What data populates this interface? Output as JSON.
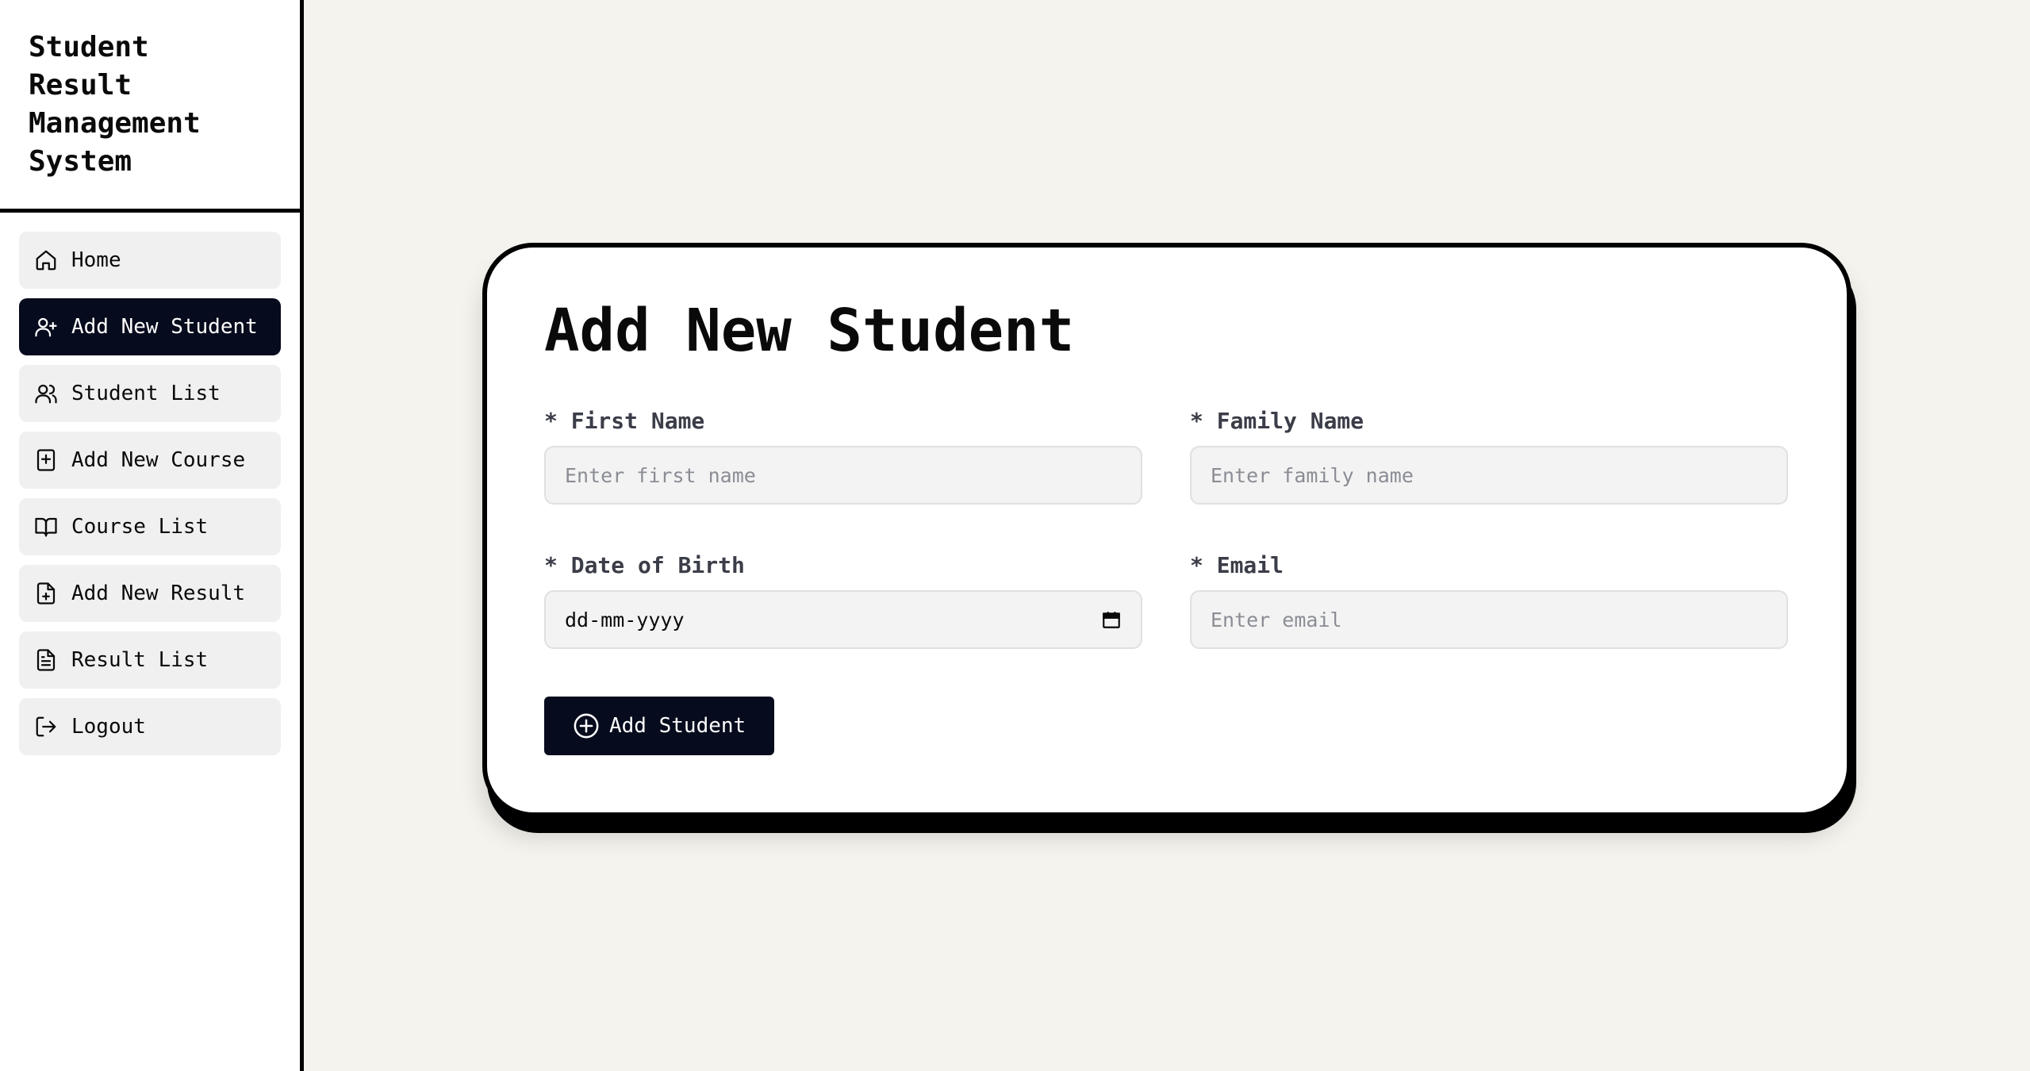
{
  "sidebar": {
    "brand_title": "Student Result Management System",
    "items": [
      {
        "label": "Home",
        "icon": "home-icon",
        "active": false
      },
      {
        "label": "Add New Student",
        "icon": "user-plus-icon",
        "active": true
      },
      {
        "label": "Student List",
        "icon": "users-icon",
        "active": false
      },
      {
        "label": "Add New Course",
        "icon": "book-plus-icon",
        "active": false
      },
      {
        "label": "Course List",
        "icon": "book-open-icon",
        "active": false
      },
      {
        "label": "Add New Result",
        "icon": "file-plus-icon",
        "active": false
      },
      {
        "label": "Result List",
        "icon": "file-text-icon",
        "active": false
      },
      {
        "label": "Logout",
        "icon": "logout-icon",
        "active": false
      }
    ]
  },
  "form": {
    "title": "Add New Student",
    "fields": {
      "first_name": {
        "label": "* First Name",
        "placeholder": "Enter first name"
      },
      "family_name": {
        "label": "* Family Name",
        "placeholder": "Enter family name"
      },
      "dob": {
        "label": "* Date of Birth",
        "placeholder": "dd-mm-yyyy"
      },
      "email": {
        "label": "* Email",
        "placeholder": "Enter email"
      }
    },
    "submit_label": "Add Student",
    "submit_icon": "plus-circle-icon"
  },
  "colors": {
    "background": "#f5f3ed",
    "accent": "#060b1d",
    "input_bg": "#f3f3f3"
  }
}
